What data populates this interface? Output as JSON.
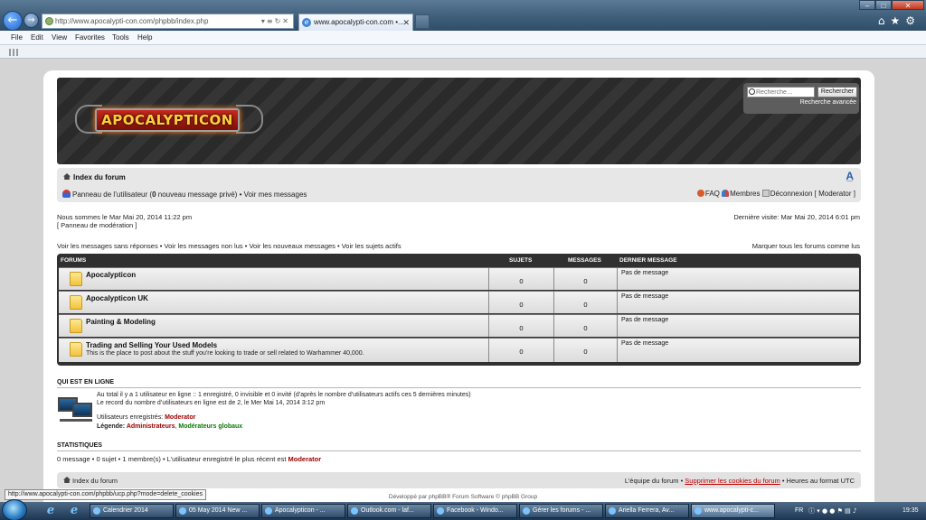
{
  "browser": {
    "url": "http://www.apocalypti-con.com/phpbb/index.php",
    "tab_title": "www.apocalypti-con.com •...",
    "menu": [
      "File",
      "Edit",
      "View",
      "Favorites",
      "Tools",
      "Help"
    ]
  },
  "header": {
    "logo_text": "APOCALYPTICON",
    "search_placeholder": "Recherche…",
    "search_button": "Rechercher",
    "advanced_search": "Recherche avancée"
  },
  "navbar": {
    "index": "Index du forum",
    "user_panel_prefix": "Panneau de l’utilisateur (",
    "new_pm_count": "0",
    "user_panel_suffix": " nouveau message privé) • Voir mes messages",
    "faq": "FAQ",
    "members": "Membres",
    "logout": "Déconnexion [ Moderator ]"
  },
  "info": {
    "current_time": "Nous sommes le Mar Mai 20, 2014 11:22 pm",
    "mod_panel": "[ Panneau de modération ]",
    "last_visit": "Dernière visite: Mar Mai 20, 2014 6:01 pm",
    "quick_links": "Voir les messages sans réponses • Voir les messages non lus • Voir les nouveaux messages • Voir les sujets actifs",
    "mark_read": "Marquer tous les forums comme lus"
  },
  "forums": {
    "headers": {
      "forum": "FORUMS",
      "topics": "SUJETS",
      "posts": "MESSAGES",
      "last": "DERNIER MESSAGE"
    },
    "rows": [
      {
        "title": "Apocalypticon",
        "desc": "",
        "topics": "0",
        "posts": "0",
        "last": "Pas de message"
      },
      {
        "title": "Apocalypticon UK",
        "desc": "",
        "topics": "0",
        "posts": "0",
        "last": "Pas de message"
      },
      {
        "title": "Painting & Modeling",
        "desc": "",
        "topics": "0",
        "posts": "0",
        "last": "Pas de message"
      },
      {
        "title": "Trading and Selling Your Used Models",
        "desc": "This is the place to post about the stuff you're looking to trade or sell related to Warhammer 40,000.",
        "topics": "0",
        "posts": "0",
        "last": "Pas de message"
      }
    ]
  },
  "online": {
    "heading": "QUI EST EN LIGNE",
    "line1": "Au total il y a 1 utilisateur en ligne :: 1 enregistré, 0 invisible et 0 invité (d’après le nombre d’utilisateurs actifs ces 5 dernières minutes)",
    "line2": "Le record du nombre d’utilisateurs en ligne est de 2, le Mer Mai 14, 2014 3:12 pm",
    "registered_label": "Utilisateurs enregistrés: ",
    "registered_user": "Moderator",
    "legend_label": "Légende: ",
    "legend_admin": "Administrateurs",
    "legend_sep": ", ",
    "legend_global": "Modérateurs globaux"
  },
  "stats": {
    "heading": "STATISTIQUES",
    "text": "0 message • 0 sujet • 1 membre(s) • L’utilisateur enregistré le plus récent est ",
    "newest": "Moderator"
  },
  "footer": {
    "index": "Index du forum",
    "team": "L’équipe du forum • ",
    "delete_cookies": "Supprimer les cookies du forum",
    "timezone": " • Heures au format UTC",
    "credits": "Développé par phpBB® Forum Software © phpBB Group"
  },
  "status_bar_url": "http://www.apocalypti-con.com/phpbb/ucp.php?mode=delete_cookies",
  "taskbar": {
    "items": [
      "Calendrier 2014",
      "05 May 2014 New ...",
      "Apocalypticon - ...",
      "Outlook.com - laf...",
      "Facebook - Windo...",
      "Gérer les forums - ...",
      "Ariella Ferrera, Av...",
      "www.apocalypti-c..."
    ],
    "lang": "FR",
    "clock": "19:35"
  }
}
